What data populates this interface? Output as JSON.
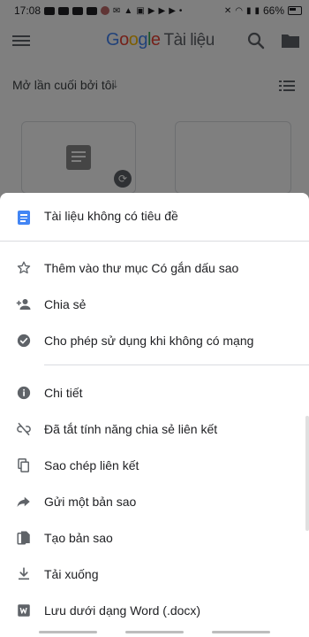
{
  "status_bar": {
    "time": "17:08",
    "battery": "66%"
  },
  "app_bar": {
    "logo_letters": [
      "G",
      "o",
      "o",
      "g",
      "l",
      "e"
    ],
    "title_suffix": "Tài liệu"
  },
  "sort": {
    "label": "Mở lần cuối bởi tôi",
    "arrow": "↓"
  },
  "sheet": {
    "title": "Tài liệu không có tiêu đề",
    "items": [
      {
        "label": "Thêm vào thư mục Có gắn dấu sao",
        "icon": "star-icon"
      },
      {
        "label": "Chia sẻ",
        "icon": "person-add-icon"
      },
      {
        "label": "Cho phép sử dụng khi không có mạng",
        "icon": "offline-check-icon"
      },
      {
        "label": "Chi tiết",
        "icon": "info-icon"
      },
      {
        "label": "Đã tắt tính năng chia sẻ liên kết",
        "icon": "link-off-icon"
      },
      {
        "label": "Sao chép liên kết",
        "icon": "copy-icon"
      },
      {
        "label": "Gửi một bản sao",
        "icon": "share-arrow-icon"
      },
      {
        "label": "Tạo bản sao",
        "icon": "duplicate-file-icon"
      },
      {
        "label": "Tải xuống",
        "icon": "download-icon"
      },
      {
        "label": "Lưu dưới dạng Word (.docx)",
        "icon": "word-icon"
      }
    ]
  },
  "colors": {
    "accent": "#4285f4",
    "icon": "#5f6368",
    "text": "#202124",
    "scrim": "rgba(0,0,0,0.5)"
  }
}
